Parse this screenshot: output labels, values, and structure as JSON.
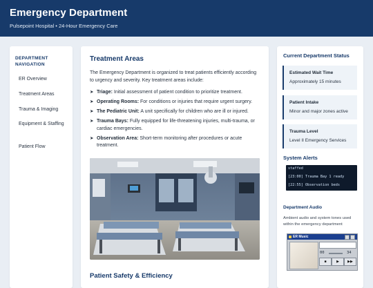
{
  "header": {
    "title": "Emergency Department",
    "subtitle": "Pulsepoint Hospital • 24-Hour Emergency Care"
  },
  "nav": {
    "title": "DEPARTMENT NAVIGATION",
    "items": [
      {
        "label": "ER Overview"
      },
      {
        "label": "Treatment Areas"
      },
      {
        "label": "Trauma & Imaging"
      },
      {
        "label": "Equipment & Staffing"
      },
      {
        "label": "Patient Flow"
      }
    ]
  },
  "main": {
    "heading": "Treatment Areas",
    "intro": "The Emergency Department is organized to treat patients efficiently according to urgency and severity. Key treatment areas include:",
    "areas": [
      {
        "name": "Triage:",
        "desc": "Initial assessment of patient condition to prioritize treatment."
      },
      {
        "name": "Operating Rooms:",
        "desc": "For conditions or injuries that require urgent surgery."
      },
      {
        "name": "The Pediatric Unit:",
        "desc": "A unit specifically for children who are ill or injured."
      },
      {
        "name": "Trauma Bays:",
        "desc": "Fully equipped for life-threatening injuries, multi-trauma, or cardiac emergencies."
      },
      {
        "name": "Observation Area:",
        "desc": "Short-term monitoring after procedures or acute treatment."
      }
    ],
    "heading2": "Patient Safety & Efficiency"
  },
  "side": {
    "status_title": "Current Department Status",
    "status": [
      {
        "label": "Estimated Wait Time",
        "value": "Approximately 15 minutes"
      },
      {
        "label": "Patient Intake",
        "value": "Minor and major zones active"
      },
      {
        "label": "Trauma Level",
        "value": "Level II Emergency Services"
      }
    ],
    "alerts_title": "System Alerts",
    "alerts": [
      "staffed",
      "[23:00] Trauma Bay 1 ready",
      "[22:55] Observation beds"
    ],
    "audio_title": "Department Audio",
    "audio_desc": "Ambient audio and system tones used within the emergency department",
    "player": {
      "title": "ER Music",
      "time_start": "00",
      "time_end": "34"
    }
  }
}
